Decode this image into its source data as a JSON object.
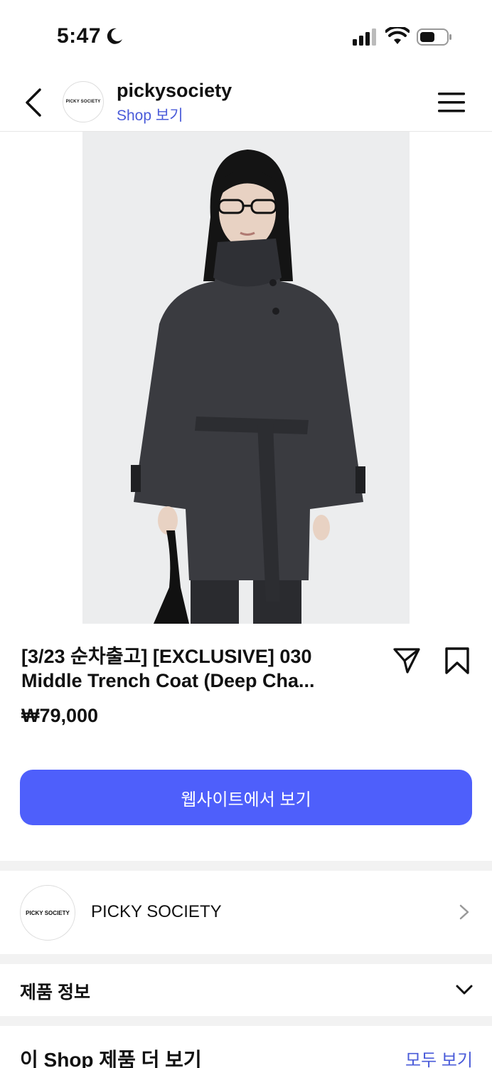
{
  "status_bar": {
    "time": "5:47",
    "icons": [
      "moon-icon",
      "cellular-signal-icon",
      "wifi-icon",
      "battery-icon"
    ]
  },
  "header": {
    "account_name": "pickysociety",
    "shop_link": "Shop 보기",
    "avatar_text": "PICKY SOCIETY",
    "icons": [
      "back-arrow-icon",
      "hamburger-menu-icon"
    ]
  },
  "product": {
    "title_line1": "[3/23 순차출고] [EXCLUSIVE] 030",
    "title_line2": "Middle Trench Coat (Deep Cha...",
    "price": "₩79,000",
    "cta_label": "웹사이트에서 보기",
    "icons": [
      "send-icon",
      "bookmark-icon"
    ]
  },
  "shop_card": {
    "avatar_text": "PICKY SOCIETY",
    "name": "PICKY SOCIETY"
  },
  "product_info": {
    "label": "제품 정보"
  },
  "more_section": {
    "label": "이 Shop 제품 더 보기",
    "see_all": "모두 보기"
  },
  "colors": {
    "accent": "#4e5ffb",
    "link": "#4a5bd9",
    "separator": "#f2f2f2",
    "coat": "#3a3b40"
  }
}
